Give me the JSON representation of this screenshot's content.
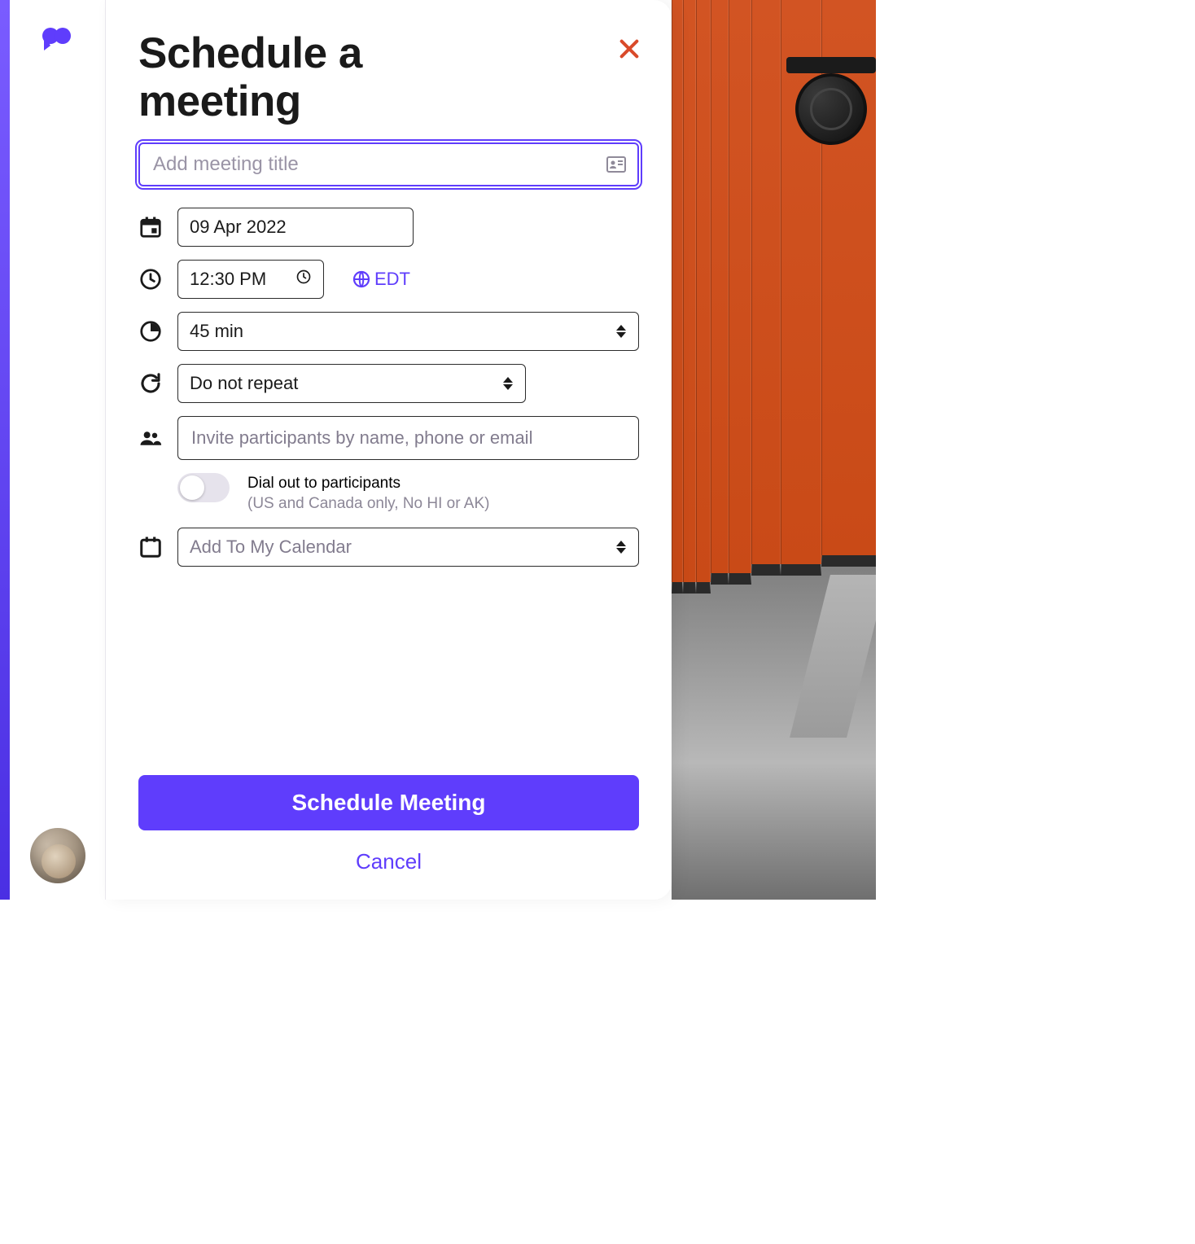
{
  "colors": {
    "accent": "#5f3dfc",
    "close": "#d94a2a"
  },
  "heading": "Schedule a meeting",
  "title_field": {
    "placeholder": "Add meeting title",
    "value": ""
  },
  "date": {
    "value": "09 Apr 2022"
  },
  "time": {
    "value": "12:30 PM",
    "timezone": "EDT"
  },
  "duration": {
    "label": "45 min"
  },
  "repeat": {
    "label": "Do not repeat"
  },
  "invite": {
    "placeholder": "Invite participants by name, phone or email"
  },
  "dialout": {
    "label": "Dial out to participants",
    "sublabel": "(US and Canada only, No HI or AK)",
    "enabled": false
  },
  "calendar": {
    "label": "Add To My Calendar"
  },
  "buttons": {
    "primary": "Schedule Meeting",
    "cancel": "Cancel"
  }
}
